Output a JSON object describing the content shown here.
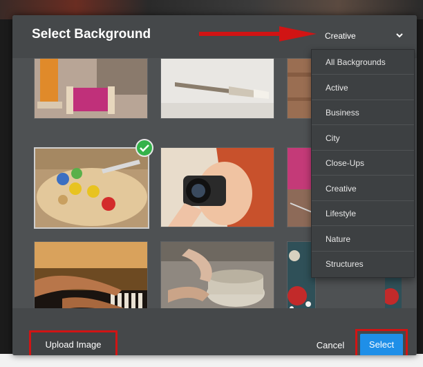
{
  "dialog": {
    "title": "Select Background",
    "selected_category": "Creative"
  },
  "categories": [
    "All Backgrounds",
    "Active",
    "Business",
    "City",
    "Close-Ups",
    "Creative",
    "Lifestyle",
    "Nature",
    "Structures"
  ],
  "footer": {
    "upload_label": "Upload Image",
    "cancel_label": "Cancel",
    "select_label": "Select"
  },
  "colors": {
    "select_button": "#1f8fe8",
    "highlight_box": "#d11414",
    "check_badge": "#34b24a",
    "annotation_arrow": "#d11414"
  },
  "images": [
    {
      "name": "thread-spools-image"
    },
    {
      "name": "paintbrush-image"
    },
    {
      "name": "wood-texture-image"
    },
    {
      "name": "paint-palette-image",
      "selected": true
    },
    {
      "name": "photographer-camera-image"
    },
    {
      "name": "yarn-knitting-image"
    },
    {
      "name": "piano-hands-image"
    },
    {
      "name": "pottery-wheel-image"
    },
    {
      "name": "sewing-pins-image"
    }
  ]
}
